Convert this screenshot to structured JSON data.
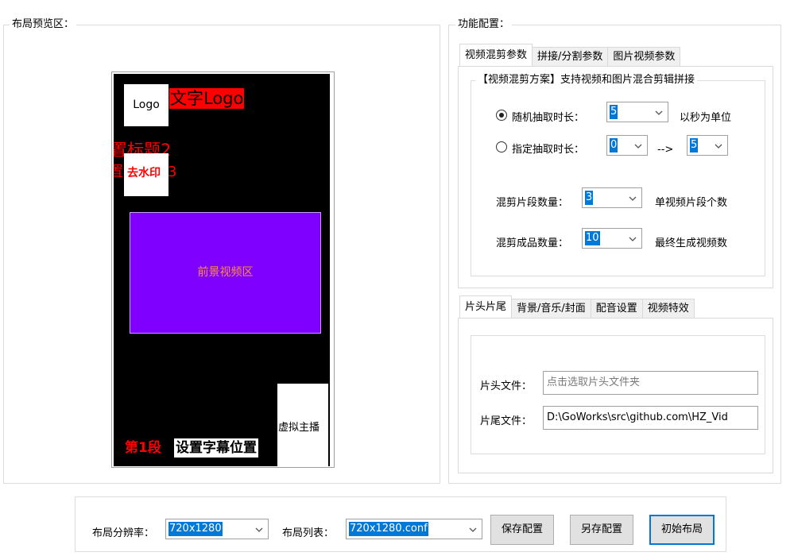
{
  "preview": {
    "group_title": "布局预览区：",
    "logo_label": "Logo",
    "text_logo": "文字Logo",
    "title2": "置标题2",
    "title3_left": "置",
    "title3_right": "3",
    "watermark": "去水印",
    "foreground": "前景视频区",
    "anchor": "虚拟主播",
    "segment": "第1段",
    "subtitle": "设置字幕位置"
  },
  "config": {
    "group_title": "功能配置：",
    "top_tabs": [
      "视频混剪参数",
      "拼接/分割参数",
      "图片视频参数"
    ],
    "scheme_title": "【视频混剪方案】支持视频和图片混合剪辑拼接",
    "random_label": "随机抽取时长：",
    "random_value": "5",
    "random_unit": "以秒为单位",
    "fixed_label": "指定抽取时长：",
    "fixed_from": "0",
    "fixed_arrow": "-->",
    "fixed_to": "5",
    "clip_count_label": "混剪片段数量：",
    "clip_count_value": "3",
    "clip_count_hint": "单视频片段个数",
    "output_count_label": "混剪成品数量：",
    "output_count_value": "10",
    "output_count_hint": "最终生成视频数",
    "bottom_tabs": [
      "片头片尾",
      "背景/音乐/封面",
      "配音设置",
      "视频特效"
    ],
    "intro_label": "片头文件：",
    "intro_placeholder": "点击选取片头文件夹",
    "outro_label": "片尾文件：",
    "outro_value": "D:\\GoWorks\\src\\github.com\\HZ_Vid"
  },
  "bottom": {
    "resolution_label": "布局分辨率：",
    "resolution_value": "720x1280",
    "layout_list_label": "布局列表：",
    "layout_list_value": "720x1280.conf",
    "save_button": "保存配置",
    "save_as_button": "另存配置",
    "init_button": "初始布局"
  },
  "colors": {
    "foreground_bg": "#7f00ff",
    "foreground_text": "#ff8c3c",
    "red": "#ff0000",
    "selection": "#0078d7"
  }
}
